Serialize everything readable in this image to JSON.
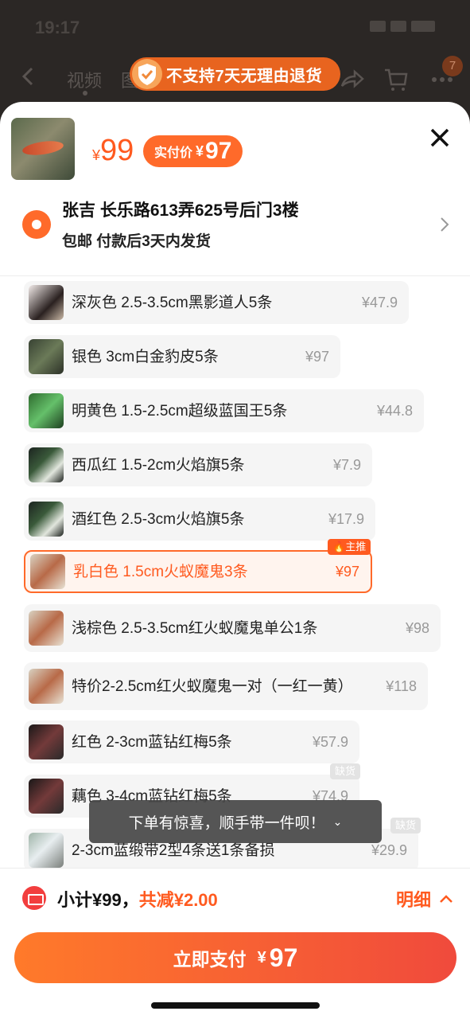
{
  "background": {
    "nav_tabs": [
      "视频",
      "图"
    ],
    "cart_badge": "7",
    "return_notice": "不支持7天无理由退货"
  },
  "product": {
    "currency": "¥",
    "price": "99",
    "real_price_label": "实付价",
    "real_price": "97"
  },
  "address": {
    "line1": "张吉  长乐路613弄625号后门3楼",
    "line2": "包邮  付款后3天内发货"
  },
  "options": [
    {
      "label": "深灰色 2.5-3.5cm黑影道人5条",
      "price": "¥47.9",
      "selected": false
    },
    {
      "label": "银色 3cm白金豹皮5条",
      "price": "¥97",
      "selected": false
    },
    {
      "label": "明黄色 1.5-2.5cm超级蓝国王5条",
      "price": "¥44.8",
      "selected": false
    },
    {
      "label": "西瓜红 1.5-2cm火焰旗5条",
      "price": "¥7.9",
      "selected": false
    },
    {
      "label": "酒红色 2.5-3cm火焰旗5条",
      "price": "¥17.9",
      "selected": false
    },
    {
      "label": "乳白色 1.5cm火蚁魔鬼3条",
      "price": "¥97",
      "selected": true,
      "tag": "主推"
    },
    {
      "label": "浅棕色 2.5-3.5cm红火蚁魔鬼单公1条",
      "price": "¥98",
      "selected": false
    },
    {
      "label": "特价2-2.5cm红火蚁魔鬼一对（一红一黄）",
      "price": "¥118",
      "selected": false
    },
    {
      "label": "红色 2-3cm蓝钻红梅5条",
      "price": "¥57.9",
      "selected": false
    },
    {
      "label": "藕色 3-4cm蓝钻红梅5条",
      "price": "¥74.9",
      "selected": false,
      "tag": "缺货"
    },
    {
      "label": "2-3cm蓝缎带2型4条送1条备损",
      "price": "¥29.9",
      "selected": false,
      "tag": "缺货"
    }
  ],
  "toast": "下单有惊喜，顺手带一件呗！",
  "footer": {
    "subtotal": "小计¥99，",
    "discount": "共减¥2.00",
    "detail_link": "明细",
    "pay_label": "立即支付",
    "pay_currency": "¥",
    "pay_amount": "97"
  },
  "colors": {
    "accent": "#ff5a1f",
    "pay_gradient_start": "#ff7a2a",
    "pay_gradient_end": "#f04a3c"
  }
}
